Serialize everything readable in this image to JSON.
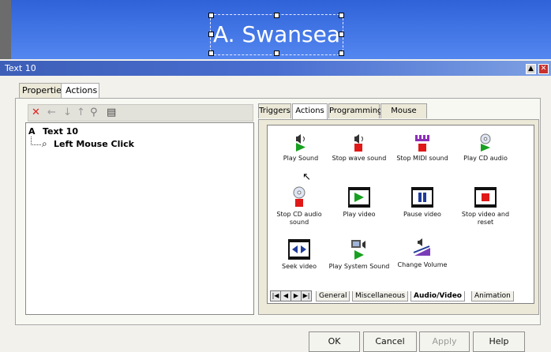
{
  "canvas": {
    "title": "A. Swansea",
    "background_color": "#3d6fe3"
  },
  "window": {
    "title": "Text 10",
    "accent": "#3d5fb8"
  },
  "tabs": {
    "main": [
      {
        "label": "Properties"
      },
      {
        "label": "Actions"
      }
    ],
    "right": [
      {
        "label": "Triggers"
      },
      {
        "label": "Actions"
      },
      {
        "label": "Programming"
      },
      {
        "label": "Mouse Click"
      }
    ],
    "categories": [
      {
        "label": "General"
      },
      {
        "label": "Miscellaneous"
      },
      {
        "label": "Audio/Video"
      },
      {
        "label": "Animation"
      }
    ]
  },
  "toolbar": {
    "icons": [
      "delete-icon",
      "arrow-left-icon",
      "arrow-down-icon",
      "arrow-up-icon",
      "person-icon",
      "printer-icon"
    ]
  },
  "tree": {
    "root": "Text 10",
    "child": "Left Mouse Click"
  },
  "actions": [
    {
      "label": "Play Sound",
      "icon": "play-sound-icon"
    },
    {
      "label": "Stop wave sound",
      "icon": "stop-wave-sound-icon"
    },
    {
      "label": "Stop MIDI sound",
      "icon": "stop-midi-sound-icon"
    },
    {
      "label": "Play CD audio",
      "icon": "cd-play-icon"
    },
    {
      "label": "Stop CD audio sound",
      "icon": "cd-stop-icon"
    },
    {
      "label": "Play video",
      "icon": "video-play-icon"
    },
    {
      "label": "Pause video",
      "icon": "video-pause-icon"
    },
    {
      "label": "Stop video and reset",
      "icon": "video-stop-icon"
    },
    {
      "label": "Seek video",
      "icon": "video-seek-icon"
    },
    {
      "label": "Play System Sound",
      "icon": "system-sound-icon"
    },
    {
      "label": "Change Volume",
      "icon": "volume-icon"
    }
  ],
  "buttons": {
    "ok": "OK",
    "cancel": "Cancel",
    "apply": "Apply",
    "help": "Help"
  }
}
